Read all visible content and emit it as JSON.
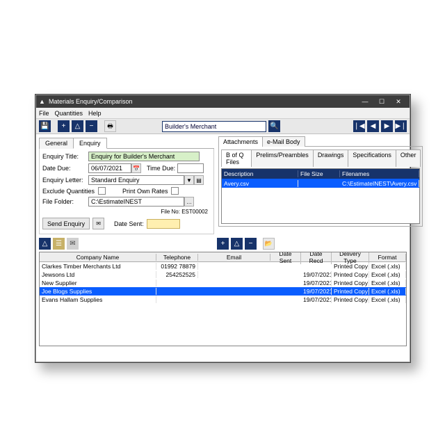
{
  "window": {
    "title": "Materials Enquiry/Comparison"
  },
  "menu": {
    "file": "File",
    "quantities": "Quantities",
    "help": "Help"
  },
  "toolbar": {
    "merchant": "Builder's Merchant"
  },
  "tabs": {
    "general": "General",
    "enquiry": "Enquiry"
  },
  "form": {
    "enquiry_title_label": "Enquiry Title:",
    "enquiry_title_value": "Enquiry for Builder's Merchant",
    "date_due_label": "Date Due:",
    "date_due_value": "06/07/2021",
    "time_due_label": "Time Due:",
    "enquiry_letter_label": "Enquiry Letter:",
    "enquiry_letter_value": "Standard Enquiry",
    "exclude_q_label": "Exclude Quantities",
    "print_rates_label": "Print Own Rates",
    "file_folder_label": "File Folder:",
    "file_folder_value": "C:\\EstimateINEST",
    "file_no_label": "File No: EST00002",
    "send_label": "Send Enquiry",
    "date_sent_label": "Date Sent:"
  },
  "right_tabs": {
    "attachments": "Attachments",
    "email": "e-Mail Body",
    "boq": "B of Q Files",
    "prelims": "Prelims/Preambles",
    "drawings": "Drawings",
    "specs": "Specifications",
    "other": "Other"
  },
  "files_head": {
    "desc": "Description",
    "size": "File Size",
    "fname": "Filenames"
  },
  "files": [
    {
      "desc": "Avery.csv",
      "size": "",
      "fname": "C:\\EstimateINEST\\Avery.csv"
    }
  ],
  "lower_head": {
    "name": "Company Name",
    "tel": "Telephone",
    "email": "Email",
    "ds": "Date Sent",
    "dr": "Date Recd",
    "dt": "Delivery Type",
    "fmt": "Format"
  },
  "suppliers": [
    {
      "name": "Clarkes Timber Merchants Ltd",
      "tel": "01992 78879",
      "email": "",
      "ds": "",
      "dr": "",
      "dt": "Printed Copy",
      "fmt": "Excel (.xls)"
    },
    {
      "name": "Jewsons Ltd",
      "tel": "254252525",
      "email": "",
      "ds": "",
      "dr": "19/07/2021",
      "dt": "Printed Copy",
      "fmt": "Excel (.xls)"
    },
    {
      "name": "New Supplier",
      "tel": "",
      "email": "",
      "ds": "",
      "dr": "19/07/2021",
      "dt": "Printed Copy",
      "fmt": "Excel (.xls)"
    },
    {
      "name": "Joe Blogs Supplies",
      "tel": "",
      "email": "",
      "ds": "",
      "dr": "19/07/2021",
      "dt": "Printed Copy",
      "fmt": "Excel (.xls)"
    },
    {
      "name": "Evans Hallam Supplies",
      "tel": "",
      "email": "",
      "ds": "",
      "dr": "19/07/2021",
      "dt": "Printed Copy",
      "fmt": "Excel (.xls)"
    }
  ]
}
